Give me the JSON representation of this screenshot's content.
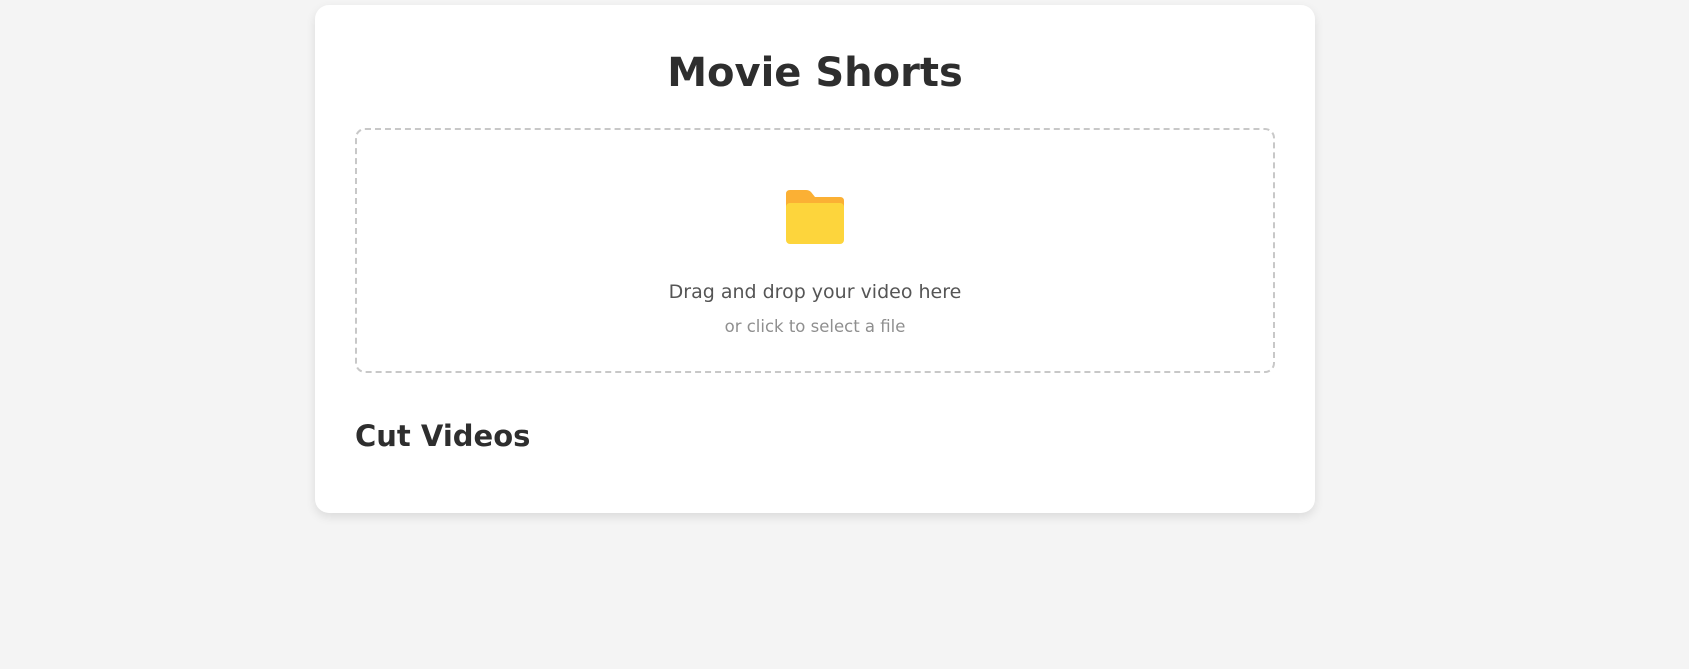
{
  "app": {
    "title": "Movie Shorts"
  },
  "upload": {
    "icon": "folder-icon",
    "primary_text": "Drag and drop your video here",
    "secondary_text": "or click to select a file"
  },
  "videos": {
    "heading": "Cut Videos",
    "items": []
  },
  "colors": {
    "background": "#f4f4f4",
    "card": "#ffffff",
    "folder_back": "#fbb034",
    "folder_front": "#fdd53c"
  }
}
